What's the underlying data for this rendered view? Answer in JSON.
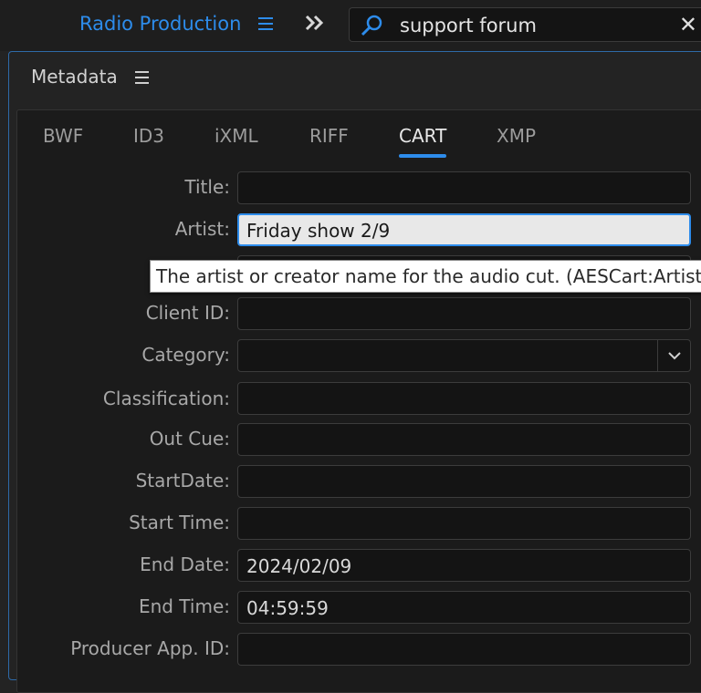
{
  "topbar": {
    "workspace_title": "Radio Production",
    "workspace_menu_icon": "hamburger-icon",
    "overflow_icon": "double-chevron-right-icon",
    "search": {
      "value": "support forum",
      "icon": "search-icon",
      "clear_icon": "close-icon"
    }
  },
  "panel": {
    "title": "Metadata",
    "menu_icon": "hamburger-icon",
    "tabs": [
      {
        "label": "BWF",
        "active": false
      },
      {
        "label": "ID3",
        "active": false
      },
      {
        "label": "iXML",
        "active": false
      },
      {
        "label": "RIFF",
        "active": false
      },
      {
        "label": "CART",
        "active": true
      },
      {
        "label": "XMP",
        "active": false
      }
    ],
    "fields": {
      "title": {
        "label": "Title:",
        "value": ""
      },
      "artist": {
        "label": "Artist:",
        "value": "Friday show 2/9"
      },
      "client_id": {
        "label": "Client ID:",
        "value": ""
      },
      "category": {
        "label": "Category:",
        "value": ""
      },
      "classification": {
        "label": "Classification:",
        "value": ""
      },
      "out_cue": {
        "label": "Out Cue:",
        "value": ""
      },
      "start_date": {
        "label": "StartDate:",
        "value": ""
      },
      "start_time": {
        "label": "Start Time:",
        "value": ""
      },
      "end_date": {
        "label": "End Date:",
        "value": "2024/02/09"
      },
      "end_time": {
        "label": "End Time:",
        "value": "04:59:59"
      },
      "producer_app_id": {
        "label": "Producer App. ID:",
        "value": ""
      }
    },
    "tooltip": "The artist or creator name for the audio cut. (AESCart:Artist)"
  },
  "colors": {
    "accent": "#2d8ceb",
    "background": "#232323",
    "field": "#141414"
  }
}
